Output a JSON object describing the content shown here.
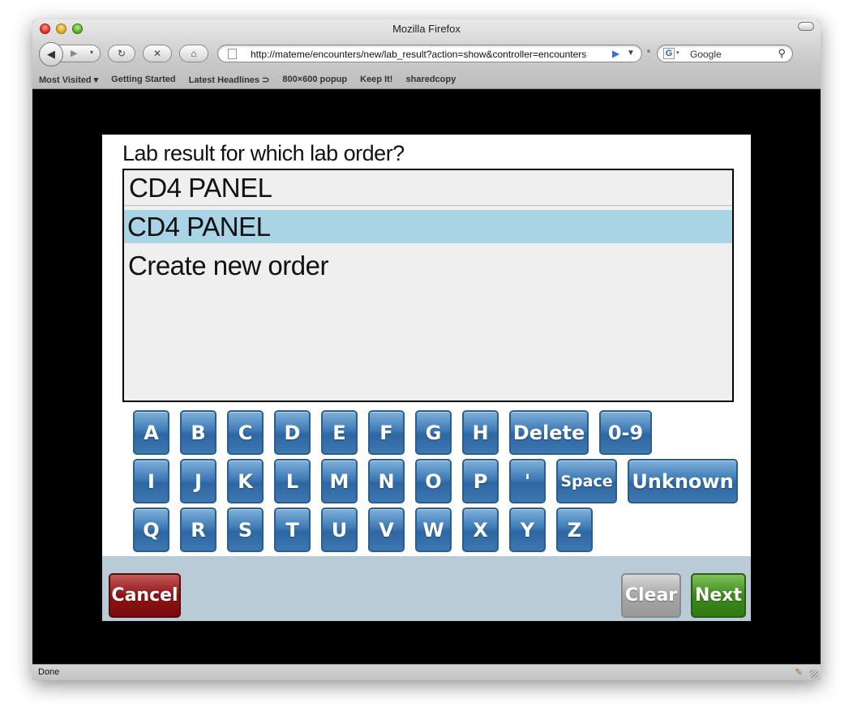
{
  "window": {
    "title": "Mozilla Firefox"
  },
  "toolbar": {
    "back_glyph": "◀",
    "forward_glyph": "▶",
    "dropdown_glyph": "▾",
    "reload_glyph": "↻",
    "stop_glyph": "✕",
    "home_glyph": "⌂",
    "url": "http://mateme/encounters/new/lab_result?action=show&controller=encounters",
    "go_glyph": "▶",
    "url_dropdown_glyph": "▼",
    "search_engine_glyph": "G",
    "search_placeholder": "Google",
    "search_glyph": "⚲"
  },
  "bookmarks": [
    {
      "label": "Most Visited ▾"
    },
    {
      "label": "Getting Started"
    },
    {
      "label": "Latest Headlines ⊃"
    },
    {
      "label": "800×600 popup"
    },
    {
      "label": "Keep It!"
    },
    {
      "label": "sharedcopy"
    }
  ],
  "question": "Lab result for which lab order?",
  "list": {
    "input_value": "CD4 PANEL",
    "options": [
      "CD4 PANEL",
      "Create new order"
    ],
    "selected_index": 0
  },
  "keyboard": {
    "row1": [
      "A",
      "B",
      "C",
      "D",
      "E",
      "F",
      "G",
      "H",
      "Delete",
      "0-9"
    ],
    "row2": [
      "I",
      "J",
      "K",
      "L",
      "M",
      "N",
      "O",
      "P",
      "'",
      "Space",
      "Unknown"
    ],
    "row3": [
      "Q",
      "R",
      "S",
      "T",
      "U",
      "V",
      "W",
      "X",
      "Y",
      "Z"
    ]
  },
  "footer": {
    "cancel": "Cancel",
    "clear": "Clear",
    "next": "Next"
  },
  "status": {
    "text": "Done"
  },
  "colors": {
    "key_blue": "#3e7ab5",
    "selected_row": "#a9d4e5",
    "cancel_red": "#8e1414",
    "clear_gray": "#a6a6a6",
    "next_green": "#3c8a1a",
    "footer_bg": "#b9cbd6"
  }
}
